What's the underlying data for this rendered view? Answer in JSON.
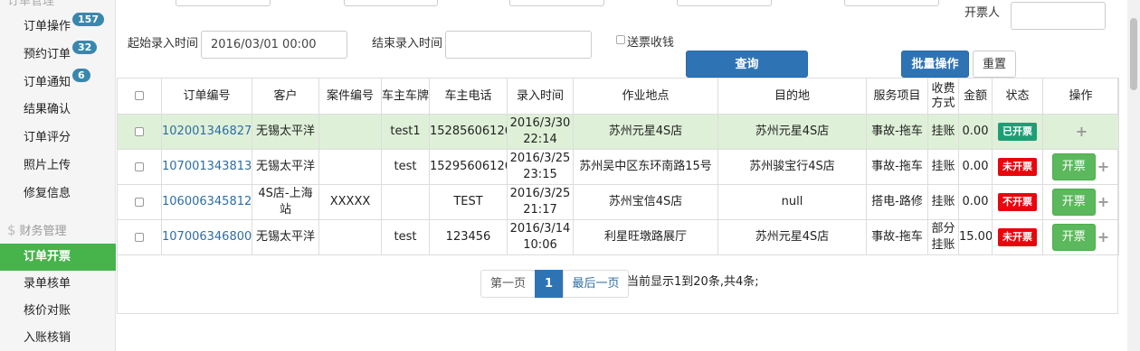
{
  "sidebar": {
    "top_cut": "订单管理",
    "items_orders": [
      {
        "label": "订单操作",
        "badge": "157"
      },
      {
        "label": "预约订单",
        "badge": "32"
      },
      {
        "label": "订单通知",
        "badge": "6"
      },
      {
        "label": "结果确认",
        "badge": null
      },
      {
        "label": "订单评分",
        "badge": null
      },
      {
        "label": "照片上传",
        "badge": null
      },
      {
        "label": "修复信息",
        "badge": null
      }
    ],
    "finance_section": {
      "icon": "dollar-icon",
      "icon_glyph": "$",
      "label": "财务管理"
    },
    "items_finance": [
      {
        "label": "订单开票",
        "active": true
      },
      {
        "label": "录单核单",
        "active": false
      },
      {
        "label": "核价对账",
        "active": false
      },
      {
        "label": "入账核销",
        "active": false
      }
    ]
  },
  "form": {
    "ticket_person_label": "开票人",
    "ticket_person_value": "",
    "start_time_label": "起始录入时间",
    "start_time_value": "2016/03/01 00:00",
    "end_time_label": "结束录入时间",
    "end_time_value": "",
    "send_ticket_label": "送票收钱",
    "query_button": "查询",
    "batch_button": "批量操作",
    "reset_button": "重置"
  },
  "table": {
    "headers": [
      "",
      "订单编号",
      "客户",
      "案件编号",
      "车主车牌",
      "车主电话",
      "录入时间",
      "作业地点",
      "目的地",
      "服务项目",
      "收费方式",
      "金额",
      "状态",
      "操作"
    ],
    "rows": [
      {
        "order_no": "102001346827",
        "customer": "无锡太平洋",
        "case_no": "",
        "plate": "test1",
        "phone": "15285606126",
        "time_date": "2016/3/30",
        "time_clock": "22:14",
        "work_place": "苏州元星4S店",
        "destination": "苏州元星4S店",
        "service": "事故-拖车",
        "pay_method": "挂账",
        "amount": "0.00",
        "status": "已开票",
        "status_color": "#1e9e74",
        "op_label": "",
        "highlighted": true
      },
      {
        "order_no": "107001343813",
        "customer": "无锡太平洋",
        "case_no": "",
        "plate": "test",
        "phone": "15295606126",
        "time_date": "2016/3/25",
        "time_clock": "23:15",
        "work_place": "苏州吴中区东环南路15号",
        "destination": "苏州骏宝行4S店",
        "service": "事故-拖车",
        "pay_method": "挂账",
        "amount": "0.00",
        "status": "未开票",
        "status_color": "#e8060c",
        "op_label": "开票",
        "highlighted": false
      },
      {
        "order_no": "106006345812",
        "customer": "4S店-上海站",
        "case_no": "XXXXX",
        "plate": "",
        "phone": "TEST",
        "time_date": "2016/3/25",
        "time_clock": "21:17",
        "work_place": "苏州宝信4S店",
        "destination": "null",
        "service": "搭电-路修",
        "pay_method": "挂账",
        "amount": "0.00",
        "status": "不开票",
        "status_color": "#e8060c",
        "op_label": "开票",
        "highlighted": false
      },
      {
        "order_no": "107006346800",
        "customer": "无锡太平洋",
        "case_no": "",
        "plate": "test",
        "phone": "123456",
        "time_date": "2016/3/14",
        "time_clock": "10:06",
        "work_place": "利星旺墩路展厅",
        "destination": "苏州元星4S店",
        "service": "事故-拖车",
        "pay_method": "部分挂账",
        "amount": "15.00",
        "status": "未开票",
        "status_color": "#e8060c",
        "op_label": "开票",
        "highlighted": false
      }
    ],
    "plus_glyph": "+"
  },
  "pagination": {
    "first": "第一页",
    "current": "1",
    "last": "最后一页",
    "info": "当前显示1到20条,共4条;"
  }
}
